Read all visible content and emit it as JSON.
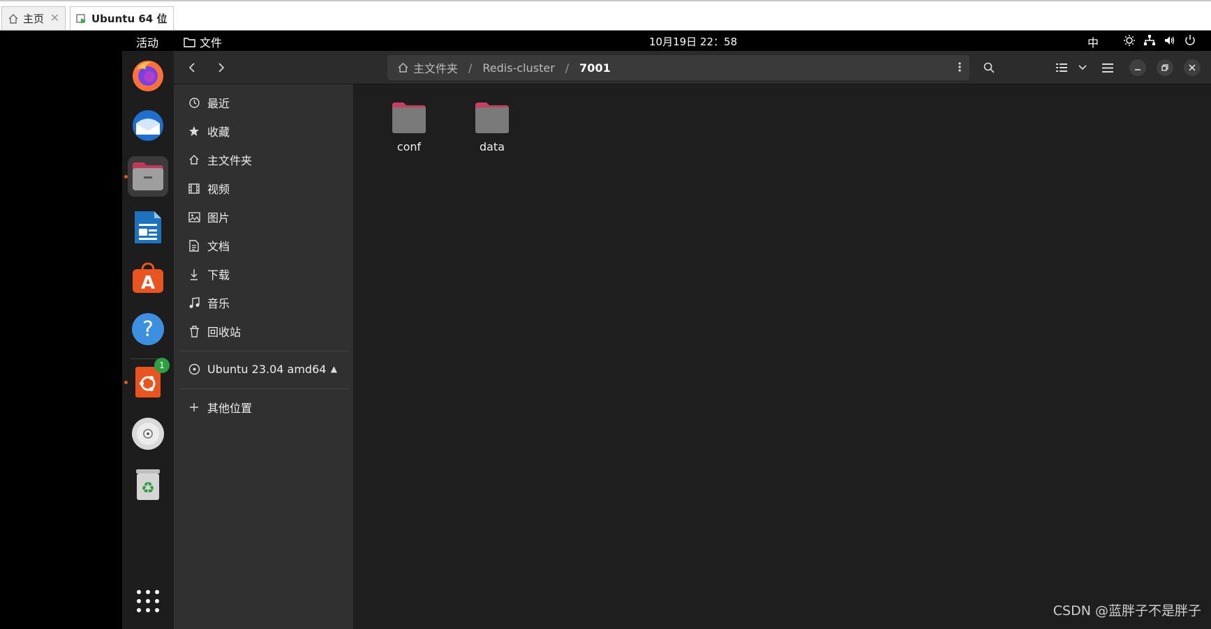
{
  "vm_tabs": [
    {
      "label": "主页",
      "icon": "home-icon"
    },
    {
      "label": "Ubuntu 64 位",
      "icon": "vm-icon"
    }
  ],
  "topbar": {
    "activities": "活动",
    "app_menu": "文件",
    "clock": "10月19日  22：58",
    "ime": "中"
  },
  "dock": {
    "items": [
      "firefox",
      "thunderbird",
      "files",
      "libreoffice-writer",
      "app-center",
      "help",
      "ubuntu-installer",
      "dvd",
      "trash",
      "show-apps"
    ],
    "installer_badge": "1"
  },
  "headerbar": {
    "path": [
      {
        "label": "主文件夹",
        "icon": "home-icon"
      },
      {
        "label": "Redis-cluster"
      },
      {
        "label": "7001"
      }
    ]
  },
  "sidebar": {
    "places": [
      {
        "label": "最近",
        "icon": "clock-icon"
      },
      {
        "label": "收藏",
        "icon": "star-icon"
      },
      {
        "label": "主文件夹",
        "icon": "home-icon"
      },
      {
        "label": "视频",
        "icon": "film-icon"
      },
      {
        "label": "图片",
        "icon": "image-icon"
      },
      {
        "label": "文档",
        "icon": "document-icon"
      },
      {
        "label": "下载",
        "icon": "download-icon"
      },
      {
        "label": "音乐",
        "icon": "music-icon"
      },
      {
        "label": "回收站",
        "icon": "trash-icon"
      }
    ],
    "device": {
      "label": "Ubuntu 23.04 amd64",
      "icon": "disc-icon"
    },
    "other": {
      "label": "其他位置",
      "icon": "plus-icon"
    }
  },
  "files": [
    {
      "name": "conf",
      "type": "folder"
    },
    {
      "name": "data",
      "type": "folder"
    }
  ],
  "watermark": "CSDN @蓝胖子不是胖子",
  "colors": {
    "accent": "#e95420",
    "folder": "#7a7a7a",
    "folder_tab": "#c7405f",
    "badge": "#2ea043"
  }
}
